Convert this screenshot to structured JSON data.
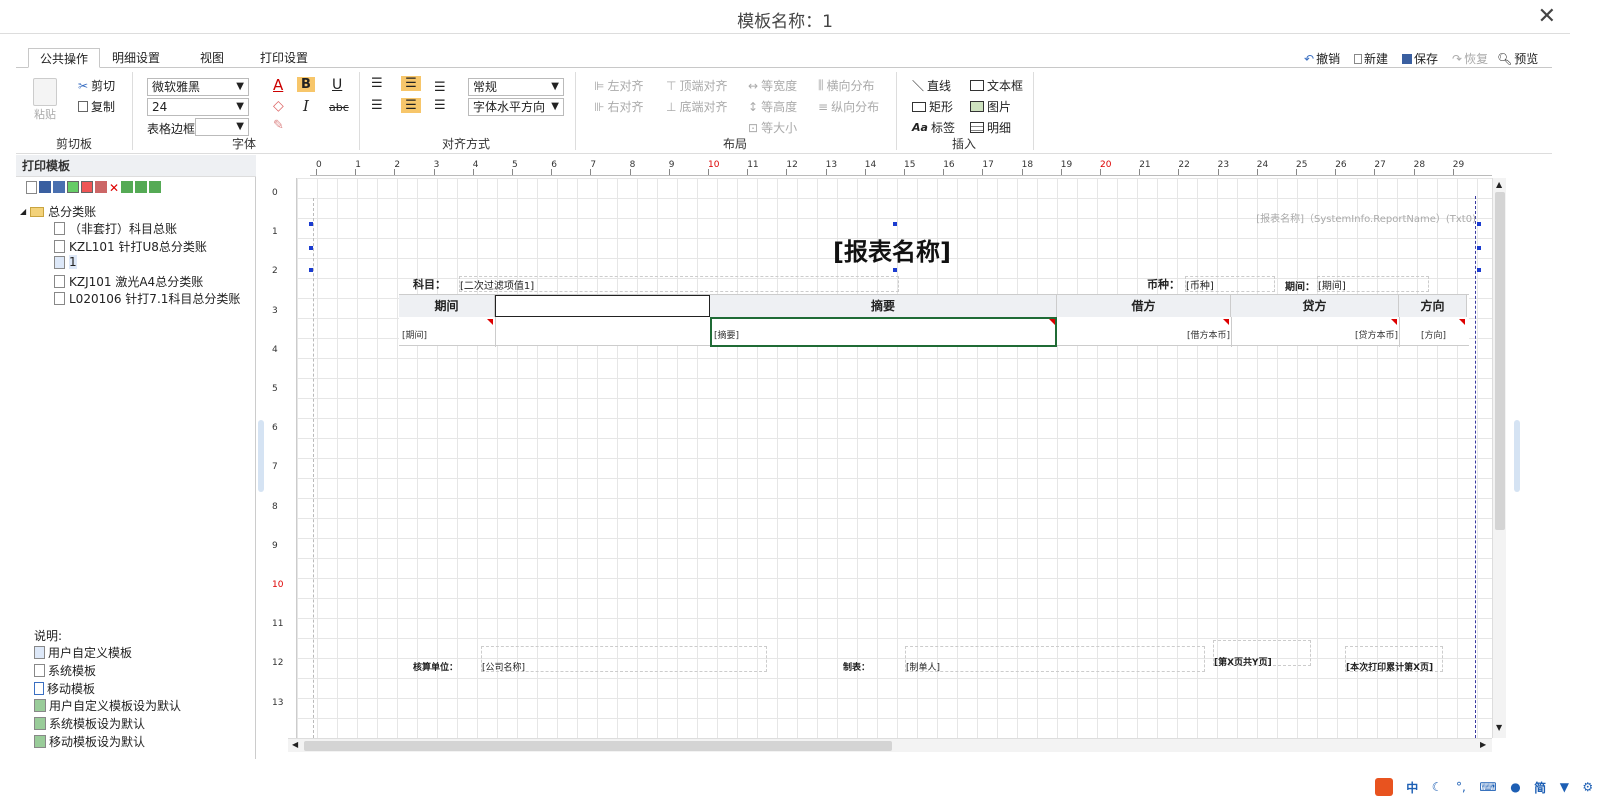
{
  "window": {
    "title": "模板名称：1"
  },
  "tabs": [
    "公共操作",
    "明细设置",
    "视图",
    "打印设置"
  ],
  "quick_actions": [
    {
      "label": "撤销",
      "disabled": false
    },
    {
      "label": "新建",
      "disabled": false
    },
    {
      "label": "保存",
      "disabled": false
    },
    {
      "label": "恢复",
      "disabled": true
    },
    {
      "label": "预览",
      "disabled": false
    }
  ],
  "clipboard": {
    "paste": "粘贴",
    "cut": "剪切",
    "copy": "复制",
    "group": "剪切板"
  },
  "font": {
    "family": "微软雅黑",
    "size": "24",
    "border_label": "表格边框",
    "border_value": "",
    "group": "字体",
    "bold": "B",
    "italic": "I",
    "underline": "U",
    "strike": "abc",
    "color_a": "A"
  },
  "align": {
    "style": "常规",
    "horizontal": "字体水平方向",
    "group": "对齐方式"
  },
  "layout": {
    "left_align": "左对齐",
    "right_align": "右对齐",
    "top_align": "顶端对齐",
    "bottom_align": "底端对齐",
    "same_width": "等宽度",
    "same_height": "等高度",
    "same_size": "等大小",
    "h_dist": "横向分布",
    "v_dist": "纵向分布",
    "group": "布局"
  },
  "insert": {
    "line": "直线",
    "rect": "矩形",
    "label": "标签",
    "textbox": "文本框",
    "image": "图片",
    "detail": "明细",
    "group": "插入"
  },
  "left_panel": {
    "title": "打印模板",
    "tree": [
      {
        "label": "总分类账",
        "level": 0,
        "type": "folder"
      },
      {
        "label": "（非套打）科目总账",
        "level": 1,
        "type": "doc"
      },
      {
        "label": "KZL101 针打U8总分类账",
        "level": 1,
        "type": "doc"
      },
      {
        "label": "1",
        "level": 1,
        "type": "user"
      },
      {
        "label": "KZJ101 激光A4总分类账",
        "level": 1,
        "type": "doc"
      },
      {
        "label": "L020106 针打7.1科目总分类账",
        "level": 1,
        "type": "doc"
      }
    ],
    "legend_title": "说明:",
    "legend": [
      "用户自定义模板",
      "系统模板",
      "移动模板",
      "用户自定义模板设为默认",
      "系统模板设为默认",
      "移动模板设为默认"
    ]
  },
  "ruler": {
    "h": [
      "0",
      "1",
      "2",
      "3",
      "4",
      "5",
      "6",
      "7",
      "8",
      "9",
      "10",
      "11",
      "12",
      "13",
      "14",
      "15",
      "16",
      "17",
      "18",
      "19",
      "20",
      "21",
      "22",
      "23",
      "24",
      "25",
      "26",
      "27",
      "28",
      "29"
    ],
    "v": [
      "0",
      "1",
      "2",
      "3",
      "4",
      "5",
      "6",
      "7",
      "8",
      "9",
      "10",
      "11",
      "12",
      "13"
    ]
  },
  "report": {
    "system_name": "[报表名称]（SystemInfo.ReportName）(Txt0)",
    "title": "[报表名称]",
    "subject_label": "科目：",
    "subject_value": "[二次过滤项值1]",
    "currency_label": "币种：",
    "currency_value": "[币种]",
    "period_label": "期间：",
    "period_value": "[期间]",
    "headers": [
      "期间",
      "",
      "摘要",
      "借方",
      "贷方",
      "方向"
    ],
    "row": [
      "[期间]",
      "",
      "[摘要]",
      "[借方本币]",
      "[贷方本币]",
      "[方向]"
    ],
    "footer": {
      "unit_label": "核算单位：",
      "unit_value": "[公司名称]",
      "maker_label": "制表：",
      "maker_value": "[制单人]",
      "page": "[第X页共Y页]",
      "printcount": "[本次打印累计第X页]"
    }
  },
  "tray": [
    "中",
    "简"
  ]
}
